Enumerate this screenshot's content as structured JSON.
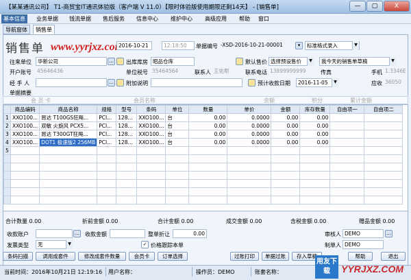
{
  "window": {
    "title": "【某某通讯公司】 T1-商贸宝IT通讯体验版（客户端 V 11.0）【限时体验版使用期限还剩14天】 - [销售单]",
    "minimize": "—",
    "maximize": "▢",
    "close": "X"
  },
  "menu": [
    "基本信息",
    "业务单据",
    "钱流单据",
    "售后服务",
    "信息中心",
    "维护中心",
    "高级应用",
    "帮助",
    "窗口"
  ],
  "tabs": [
    "导航窗体",
    "销售单"
  ],
  "form": {
    "title": "销售单",
    "watermark": "www.yyrjxz.com",
    "date_value": "2016-10-21",
    "time_value": "12:18:50",
    "doc_no_label": "单据编号",
    "doc_no_value": "-XSD-2016-10-21-00001",
    "print_format": "标准格式录入",
    "customer_label": "往来单位",
    "customer_value": "华新公司",
    "warehouse_label": "出库库房",
    "warehouse_value": "昭品仓库",
    "default_price_label": "默认售价",
    "default_price_value": "选择预设售价",
    "my_sales_label": "我今天的销售单草稿",
    "account_label": "开户账号",
    "account_value": "45646436",
    "unit_account_label": "单位税号",
    "unit_account_value": "35464564",
    "contact_label": "联系人",
    "contact_value": "王佑帮",
    "phone_label": "联系电话",
    "phone_value": "13899999999",
    "fax_label": "传真",
    "mobile_label": "手机",
    "mobile_value": "1.3346E",
    "handler_label": "经 手 人",
    "remark_label": "附加说明",
    "expected_date_label": "预计收款日期",
    "expected_date_value": "2016-11-05",
    "receivable_label": "应收",
    "receivable_value": "36050",
    "summary_label": "单据摘要"
  },
  "member_bar": {
    "member_card": "会 员 卡",
    "member_name": "会员名称",
    "balance": "余额",
    "points": "积分",
    "total_amount": "累计金额"
  },
  "grid": {
    "headers": [
      "",
      "商品编码",
      "商品名称",
      "规格",
      "型号",
      "条码",
      "单位",
      "数量",
      "单价",
      "金额",
      "库存数量",
      "自由项一",
      "自由项二"
    ],
    "rows": [
      {
        "n": "1",
        "code": "XXO100...",
        "name": "昂达 T100GS狂飚...",
        "spec": "PCI...",
        "model": "128...",
        "barcode": "XXO100...",
        "unit": "台",
        "qty": "0.00",
        "price": "0.0000",
        "amount": "0.00",
        "stock": "0.00",
        "highlight": false
      },
      {
        "n": "2",
        "code": "XXO100...",
        "name": "双敏 火旋风 PCX5...",
        "spec": "PCI...",
        "model": "128...",
        "barcode": "XXO100...",
        "unit": "台",
        "qty": "0.00",
        "price": "0.0000",
        "amount": "0.00",
        "stock": "0.00",
        "highlight": false
      },
      {
        "n": "3",
        "code": "XXO100...",
        "name": "昂达 T300GT狂飚...",
        "spec": "PCI...",
        "model": "128...",
        "barcode": "XXO100...",
        "unit": "台",
        "qty": "0.00",
        "price": "0.0000",
        "amount": "0.00",
        "stock": "0.00",
        "highlight": false
      },
      {
        "n": "4",
        "code": "XXO100...",
        "name": "DOT1 极速版2 256MB",
        "spec": "PCI...",
        "model": "128...",
        "barcode": "XXO100...",
        "unit": "台",
        "qty": "0.00",
        "price": "0.0000",
        "amount": "0.00",
        "stock": "0.00",
        "highlight": true
      },
      {
        "n": "5",
        "code": "",
        "name": "",
        "spec": "",
        "model": "",
        "barcode": "",
        "unit": "",
        "qty": "",
        "price": "",
        "amount": "",
        "stock": "",
        "highlight": false
      }
    ]
  },
  "totals": {
    "qty": "合计数量 0.00",
    "discount": "折前金额 0.00",
    "total": "合计金额 0.00",
    "deal": "成交金额 0.00",
    "tax": "含税金额 0.00",
    "gift": "赠品金额 0.00"
  },
  "bottom_form": {
    "receipt_account_label": "收款账户",
    "receipt_amount_label": "收款金额",
    "order_discount_label": "整单折让",
    "order_discount_value": "0.00",
    "auditor_label": "审核人",
    "auditor_value": "DEMO",
    "invoice_type_label": "发票类型",
    "invoice_type_value": "无",
    "price_track_label": "价格跟踪本单",
    "maker_label": "制单人",
    "maker_value": "DEMO"
  },
  "buttons": [
    "条码扫描",
    "调用成套件",
    "修改成套件数量",
    "会员卡",
    "订单选择",
    "过账打印",
    "单据过账",
    "存入草稿",
    "帮助",
    "退出"
  ],
  "status": {
    "current_time": "当前时间：2016年10月21日 12:19:16",
    "user_name": "用户名称：",
    "operator": "操作员：DEMO",
    "account_name": "账套名称："
  },
  "logos": {
    "badge": "用友下载",
    "site": "YYRJXZ.COM"
  }
}
